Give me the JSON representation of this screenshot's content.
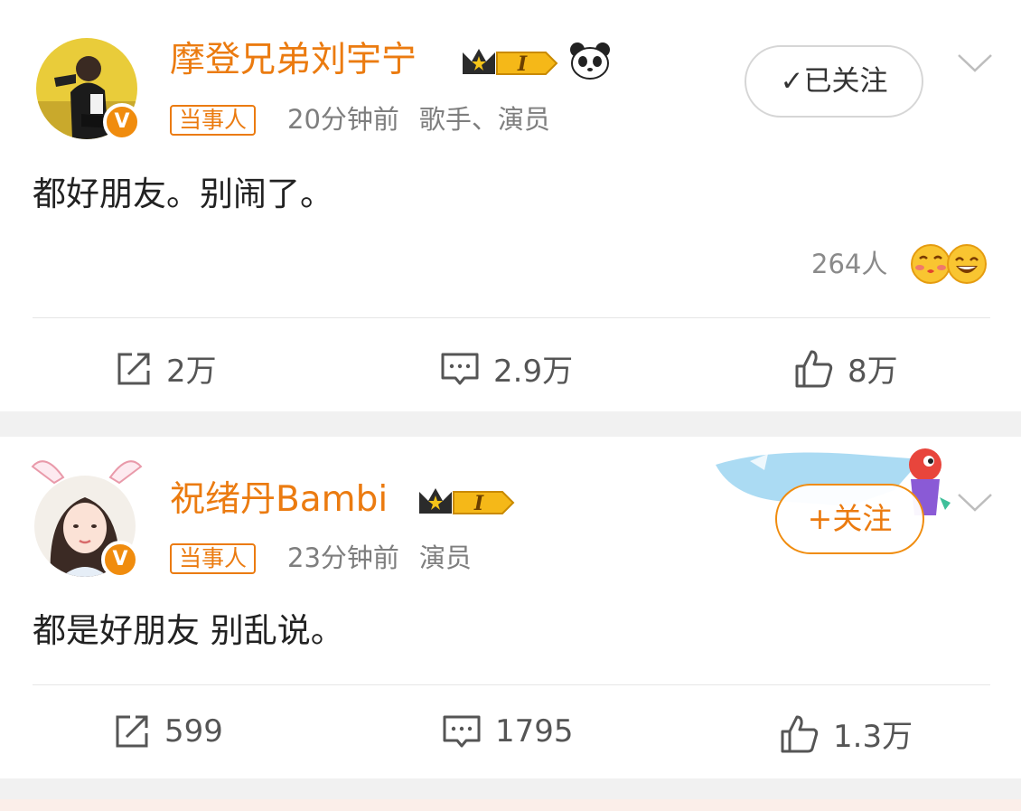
{
  "posts": [
    {
      "username": "摩登兄弟刘宇宁",
      "tag": "当事人",
      "time": "20分钟前",
      "description": "歌手、演员",
      "follow_label": "✓已关注",
      "text": "都好朋友。别闹了。",
      "reaction_count": "264人",
      "reaction_icons": [
        "kiss-face-icon",
        "grin-face-icon"
      ],
      "verified_icon": "verified-v-icon",
      "level": "I",
      "actions": {
        "repost": "2万",
        "comment": "2.9万",
        "like": "8万"
      }
    },
    {
      "username": "祝绪丹Bambi",
      "tag": "当事人",
      "time": "23分钟前",
      "description": "演员",
      "follow_label": "+关注",
      "text": "都是好朋友 别乱说。",
      "verified_icon": "verified-v-icon",
      "level": "I",
      "actions": {
        "repost": "599",
        "comment": "1795",
        "like": "1.3万"
      }
    }
  ],
  "colors": {
    "accent_orange": "#eb7b10",
    "badge_orange": "#f08c0e",
    "separator_gray": "#f1f1f1"
  }
}
